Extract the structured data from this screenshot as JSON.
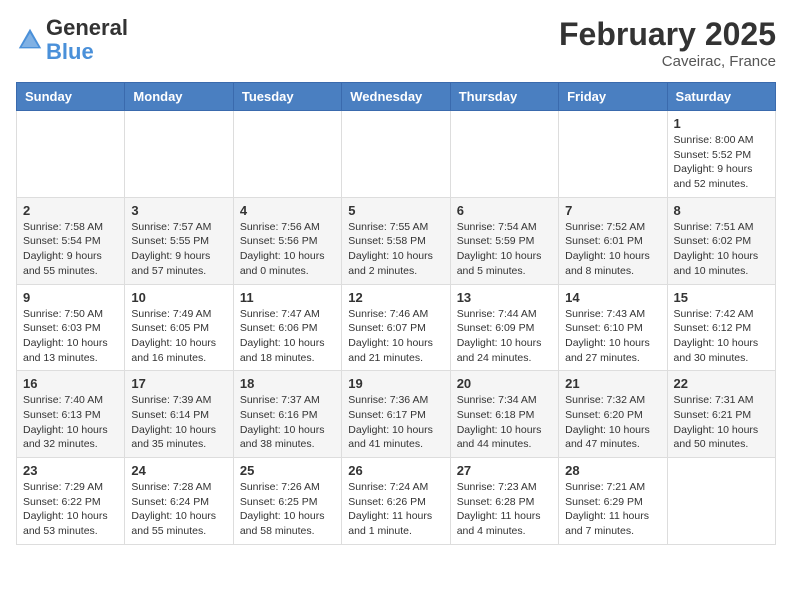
{
  "header": {
    "logo_line1": "General",
    "logo_line2": "Blue",
    "month": "February 2025",
    "location": "Caveirac, France"
  },
  "days_of_week": [
    "Sunday",
    "Monday",
    "Tuesday",
    "Wednesday",
    "Thursday",
    "Friday",
    "Saturday"
  ],
  "weeks": [
    [
      {
        "day": "",
        "content": ""
      },
      {
        "day": "",
        "content": ""
      },
      {
        "day": "",
        "content": ""
      },
      {
        "day": "",
        "content": ""
      },
      {
        "day": "",
        "content": ""
      },
      {
        "day": "",
        "content": ""
      },
      {
        "day": "1",
        "content": "Sunrise: 8:00 AM\nSunset: 5:52 PM\nDaylight: 9 hours and 52 minutes."
      }
    ],
    [
      {
        "day": "2",
        "content": "Sunrise: 7:58 AM\nSunset: 5:54 PM\nDaylight: 9 hours and 55 minutes."
      },
      {
        "day": "3",
        "content": "Sunrise: 7:57 AM\nSunset: 5:55 PM\nDaylight: 9 hours and 57 minutes."
      },
      {
        "day": "4",
        "content": "Sunrise: 7:56 AM\nSunset: 5:56 PM\nDaylight: 10 hours and 0 minutes."
      },
      {
        "day": "5",
        "content": "Sunrise: 7:55 AM\nSunset: 5:58 PM\nDaylight: 10 hours and 2 minutes."
      },
      {
        "day": "6",
        "content": "Sunrise: 7:54 AM\nSunset: 5:59 PM\nDaylight: 10 hours and 5 minutes."
      },
      {
        "day": "7",
        "content": "Sunrise: 7:52 AM\nSunset: 6:01 PM\nDaylight: 10 hours and 8 minutes."
      },
      {
        "day": "8",
        "content": "Sunrise: 7:51 AM\nSunset: 6:02 PM\nDaylight: 10 hours and 10 minutes."
      }
    ],
    [
      {
        "day": "9",
        "content": "Sunrise: 7:50 AM\nSunset: 6:03 PM\nDaylight: 10 hours and 13 minutes."
      },
      {
        "day": "10",
        "content": "Sunrise: 7:49 AM\nSunset: 6:05 PM\nDaylight: 10 hours and 16 minutes."
      },
      {
        "day": "11",
        "content": "Sunrise: 7:47 AM\nSunset: 6:06 PM\nDaylight: 10 hours and 18 minutes."
      },
      {
        "day": "12",
        "content": "Sunrise: 7:46 AM\nSunset: 6:07 PM\nDaylight: 10 hours and 21 minutes."
      },
      {
        "day": "13",
        "content": "Sunrise: 7:44 AM\nSunset: 6:09 PM\nDaylight: 10 hours and 24 minutes."
      },
      {
        "day": "14",
        "content": "Sunrise: 7:43 AM\nSunset: 6:10 PM\nDaylight: 10 hours and 27 minutes."
      },
      {
        "day": "15",
        "content": "Sunrise: 7:42 AM\nSunset: 6:12 PM\nDaylight: 10 hours and 30 minutes."
      }
    ],
    [
      {
        "day": "16",
        "content": "Sunrise: 7:40 AM\nSunset: 6:13 PM\nDaylight: 10 hours and 32 minutes."
      },
      {
        "day": "17",
        "content": "Sunrise: 7:39 AM\nSunset: 6:14 PM\nDaylight: 10 hours and 35 minutes."
      },
      {
        "day": "18",
        "content": "Sunrise: 7:37 AM\nSunset: 6:16 PM\nDaylight: 10 hours and 38 minutes."
      },
      {
        "day": "19",
        "content": "Sunrise: 7:36 AM\nSunset: 6:17 PM\nDaylight: 10 hours and 41 minutes."
      },
      {
        "day": "20",
        "content": "Sunrise: 7:34 AM\nSunset: 6:18 PM\nDaylight: 10 hours and 44 minutes."
      },
      {
        "day": "21",
        "content": "Sunrise: 7:32 AM\nSunset: 6:20 PM\nDaylight: 10 hours and 47 minutes."
      },
      {
        "day": "22",
        "content": "Sunrise: 7:31 AM\nSunset: 6:21 PM\nDaylight: 10 hours and 50 minutes."
      }
    ],
    [
      {
        "day": "23",
        "content": "Sunrise: 7:29 AM\nSunset: 6:22 PM\nDaylight: 10 hours and 53 minutes."
      },
      {
        "day": "24",
        "content": "Sunrise: 7:28 AM\nSunset: 6:24 PM\nDaylight: 10 hours and 55 minutes."
      },
      {
        "day": "25",
        "content": "Sunrise: 7:26 AM\nSunset: 6:25 PM\nDaylight: 10 hours and 58 minutes."
      },
      {
        "day": "26",
        "content": "Sunrise: 7:24 AM\nSunset: 6:26 PM\nDaylight: 11 hours and 1 minute."
      },
      {
        "day": "27",
        "content": "Sunrise: 7:23 AM\nSunset: 6:28 PM\nDaylight: 11 hours and 4 minutes."
      },
      {
        "day": "28",
        "content": "Sunrise: 7:21 AM\nSunset: 6:29 PM\nDaylight: 11 hours and 7 minutes."
      },
      {
        "day": "",
        "content": ""
      }
    ]
  ]
}
